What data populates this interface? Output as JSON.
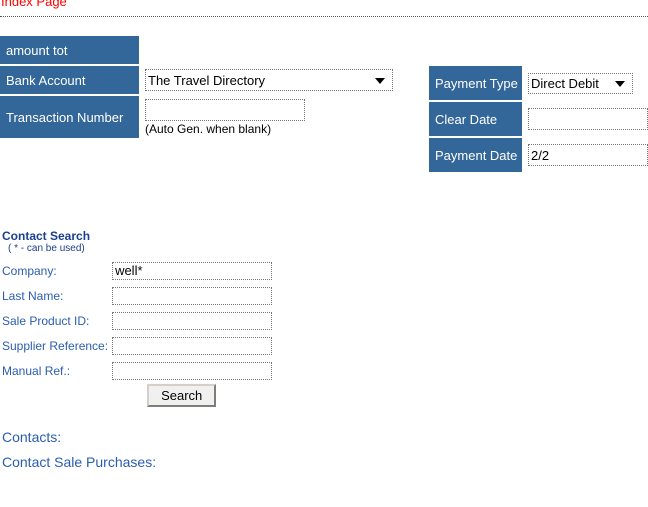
{
  "top": {
    "index_link": "Index Page"
  },
  "payment_form": {
    "left_rows": [
      {
        "label": "amount tot",
        "value": ""
      },
      {
        "label": "Bank Account",
        "value": "The Travel Directory"
      },
      {
        "label": "Transaction Number",
        "value": "",
        "hint": "(Auto Gen. when blank)"
      }
    ],
    "right_rows": [
      {
        "label": "Payment Type",
        "value": "Direct Debit"
      },
      {
        "label": "Clear Date",
        "value": ""
      },
      {
        "label": "Payment Date",
        "value": "2/2"
      }
    ],
    "bank_account_label": "Bank Account",
    "bank_account_value": "The Travel Directory",
    "amount_tot_label": "amount tot",
    "amount_tot_value": "",
    "transaction_number_label": "Transaction Number",
    "transaction_number_value": "",
    "transaction_number_hint": "(Auto Gen. when blank)",
    "payment_type_label": "Payment Type",
    "payment_type_value": "Direct Debit",
    "clear_date_label": "Clear Date",
    "clear_date_value": "",
    "payment_date_label": "Payment Date",
    "payment_date_value": "2/2"
  },
  "contact_search": {
    "title": "Contact Search",
    "subtitle": "( * - can be used)",
    "fields": [
      {
        "label": "Company:",
        "value": "well*"
      },
      {
        "label": "Last Name:",
        "value": ""
      },
      {
        "label": "Sale Product ID:",
        "value": ""
      },
      {
        "label": "Supplier Reference:",
        "value": ""
      },
      {
        "label": "Manual Ref.:",
        "value": ""
      }
    ],
    "search_button": "Search"
  },
  "bottom": {
    "contacts_label": "Contacts:",
    "contact_sale_purchases_label": "Contact Sale Purchases:"
  },
  "colors": {
    "label_blue": "#336699",
    "link_blue": "#2a5db0",
    "heading_blue": "#1a3f8f",
    "index_red": "#ff0000"
  }
}
